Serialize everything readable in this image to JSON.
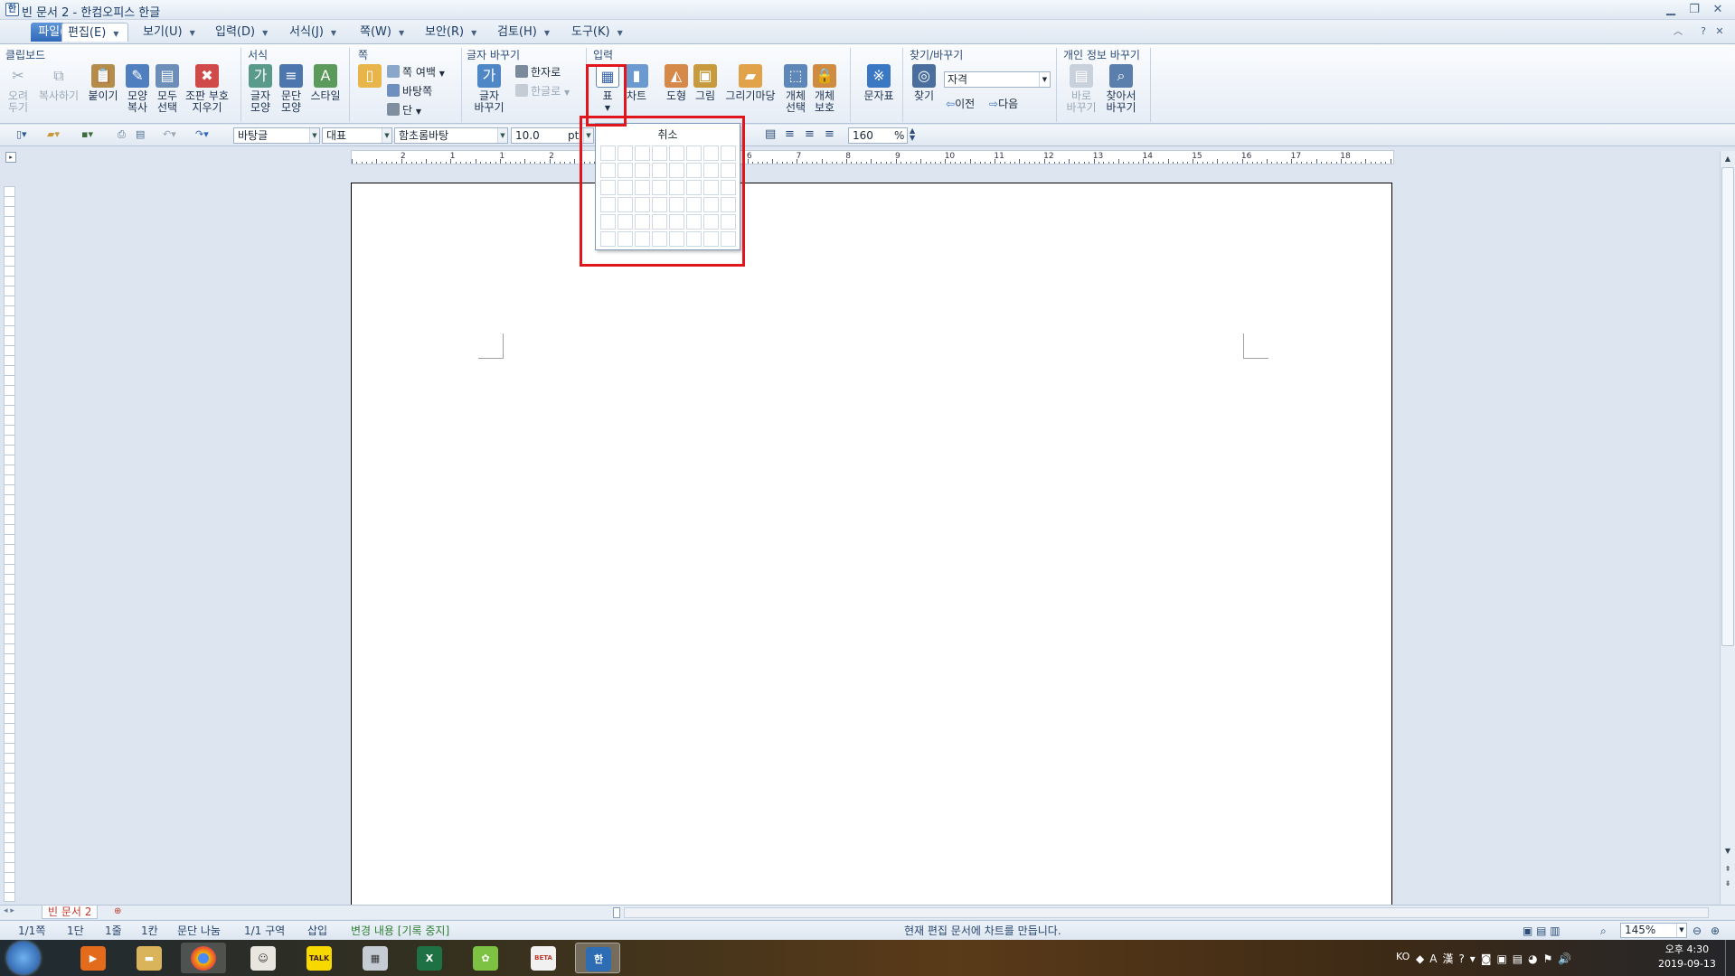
{
  "window": {
    "title": "빈 문서 2 - 한컴오피스 한글",
    "app_icon": "hwp-icon"
  },
  "menu": [
    {
      "id": "file",
      "label": "파일(F)"
    },
    {
      "id": "edit",
      "label": "편집(E)"
    },
    {
      "id": "view",
      "label": "보기(U)"
    },
    {
      "id": "input",
      "label": "입력(D)"
    },
    {
      "id": "format",
      "label": "서식(J)"
    },
    {
      "id": "page",
      "label": "쪽(W)"
    },
    {
      "id": "security",
      "label": "보안(R)"
    },
    {
      "id": "review",
      "label": "검토(H)"
    },
    {
      "id": "tools",
      "label": "도구(K)"
    }
  ],
  "ribbon": {
    "groups": {
      "clipboard": "클립보드",
      "format": "서식",
      "page": "쪽",
      "char_change": "글자 바꾸기",
      "input": "입력",
      "find": "찾기/바꾸기",
      "privacy": "개인 정보 바꾸기"
    },
    "clipboard": {
      "cut": "오려\n두기",
      "copy": "복사하기",
      "paste": "붙이기",
      "shape_copy": "모양\n복사",
      "select_all": "모두\n선택",
      "clear_markers": "조판 부호\n지우기"
    },
    "format": {
      "char_shape": "글자\n모양",
      "para_shape": "문단\n모양",
      "style": "스타일"
    },
    "page": {
      "margin": "쪽 여백",
      "background": "바탕쪽",
      "columns": "단"
    },
    "char_change": {
      "convert": "글자\n바꾸기",
      "to_hanja": "한자로",
      "to_hangul": "한글로"
    },
    "input": {
      "table": "표",
      "chart": "차트",
      "shape": "도형",
      "picture": "그림",
      "gallery": "그리기마당",
      "obj_select": "개체\n선택",
      "obj_protect": "개체\n보호",
      "symbol": "문자표"
    },
    "find": {
      "find": "찾기",
      "find_value": "자격",
      "prev": "이전",
      "next": "다음"
    },
    "privacy": {
      "replace_now": "바로\n바꾸기",
      "find_replace": "찾아서\n바꾸기"
    }
  },
  "toolbar": {
    "style": "바탕글",
    "lang": "대표",
    "font": "함초롬바탕",
    "size": "10.0",
    "unit": "pt",
    "linespacing": "160",
    "percent": "%"
  },
  "ruler": {
    "h_ticks": [
      "2",
      "1",
      "1",
      "2",
      "3",
      "4",
      "5",
      "6",
      "7",
      "8",
      "9",
      "10",
      "11",
      "12",
      "13",
      "14",
      "15",
      "16",
      "17",
      "18"
    ]
  },
  "table_popup": {
    "cancel": "취소",
    "cols": 8,
    "rows": 6
  },
  "doc_tab": {
    "name": "빈 문서 2"
  },
  "status": {
    "page": "1/1쪽",
    "col": "1단",
    "line": "1줄",
    "char": "1칸",
    "break": "문단 나눔",
    "section": "1/1 구역",
    "mode": "삽입",
    "track": "변경 내용 [기록 중지]",
    "message": "현재 편집 문서에 차트를 만듭니다.",
    "zoom": "145%"
  },
  "taskbar": {
    "lang": "KO",
    "time": "오후 4:30",
    "date": "2019-09-13",
    "apps": [
      "windows-start-icon",
      "media-player-icon",
      "file-explorer-icon",
      "chrome-icon",
      "game-app-icon",
      "kakaotalk-icon",
      "calculator-icon",
      "excel-icon",
      "sticker-app-icon",
      "beta-app-icon",
      "hwp-taskbar-icon"
    ],
    "kakao_label": "TALK",
    "beta_label": "BETA"
  },
  "highlight_color": "#e0161c"
}
